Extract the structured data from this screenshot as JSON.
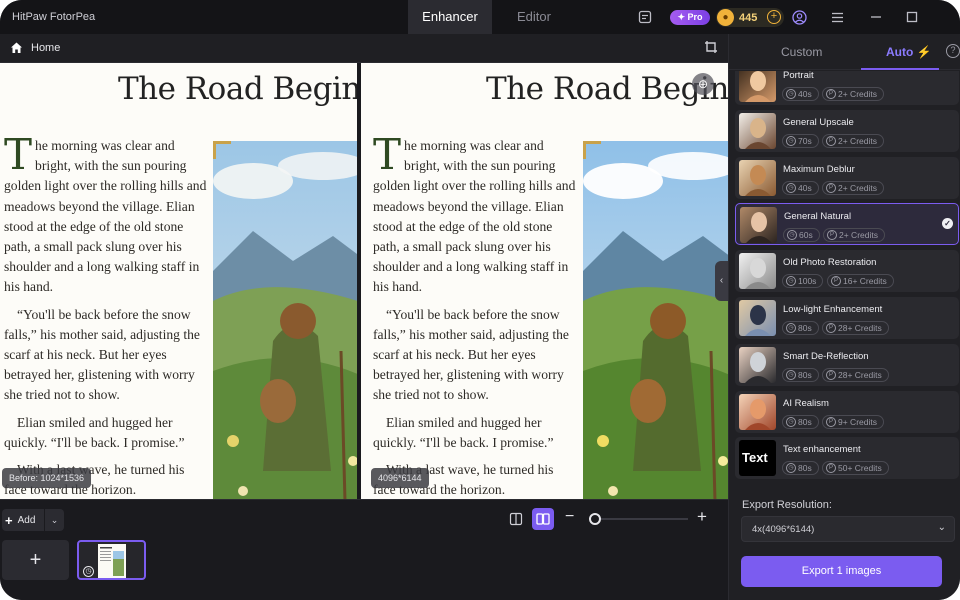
{
  "app": {
    "title": "HitPaw FotorPea"
  },
  "modes": {
    "enhancer": "Enhancer",
    "editor": "Editor",
    "active": "Enhancer"
  },
  "account": {
    "pro_label": "✦ Pro",
    "coins": "445"
  },
  "breadcrumb": {
    "home": "Home"
  },
  "page_content": {
    "title": "The Road Begins",
    "dropcap": "T",
    "paragraphs": [
      "he morning was clear and bright, with the sun pouring golden light over the rolling hills and meadows beyond the village. Elian stood at the edge of the old stone path, a small pack slung over his shoulder and a long walking staff in his hand.",
      "“You'll be back before the snow falls,” his mother said, adjusting the scarf at his neck. But her eyes betrayed her, glistening with worry she tried not to show.",
      "Elian smiled and hugged her quickly. “I'll be back. I promise.”",
      "With a last wave, he turned his face toward the horizon."
    ]
  },
  "compare": {
    "before_label": "Before: 1024*1536",
    "after_label": "4096*6144"
  },
  "bottom": {
    "add_label": "Add",
    "zoom_level": 0.05
  },
  "panel": {
    "tabs": {
      "custom": "Custom",
      "auto": "Auto"
    },
    "models": [
      {
        "name": "Portrait",
        "time": "40s",
        "credits": "2+ Credits",
        "thumb": "portrait"
      },
      {
        "name": "General Upscale",
        "time": "70s",
        "credits": "2+ Credits",
        "thumb": "upscale"
      },
      {
        "name": "Maximum Deblur",
        "time": "40s",
        "credits": "2+ Credits",
        "thumb": "cat"
      },
      {
        "name": "General Natural",
        "time": "60s",
        "credits": "2+ Credits",
        "thumb": "natural",
        "selected": true
      },
      {
        "name": "Old Photo Restoration",
        "time": "100s",
        "credits": "16+ Credits",
        "thumb": "oldphoto"
      },
      {
        "name": "Low-light Enhancement",
        "time": "80s",
        "credits": "28+ Credits",
        "thumb": "lowlight"
      },
      {
        "name": "Smart De-Reflection",
        "time": "80s",
        "credits": "28+ Credits",
        "thumb": "reflection"
      },
      {
        "name": "AI Realism",
        "time": "80s",
        "credits": "9+ Credits",
        "thumb": "realism"
      },
      {
        "name": "Text enhancement",
        "time": "80s",
        "credits": "50+ Credits",
        "thumb": "text",
        "thumb_text": "Text"
      }
    ],
    "export_resolution_label": "Export Resolution:",
    "export_resolution_value": "4x(4096*6144)",
    "export_button": "Export 1 images"
  },
  "colors": {
    "accent": "#7b5cf0",
    "background": "#1a1a1e",
    "coin": "#f1b23a"
  }
}
